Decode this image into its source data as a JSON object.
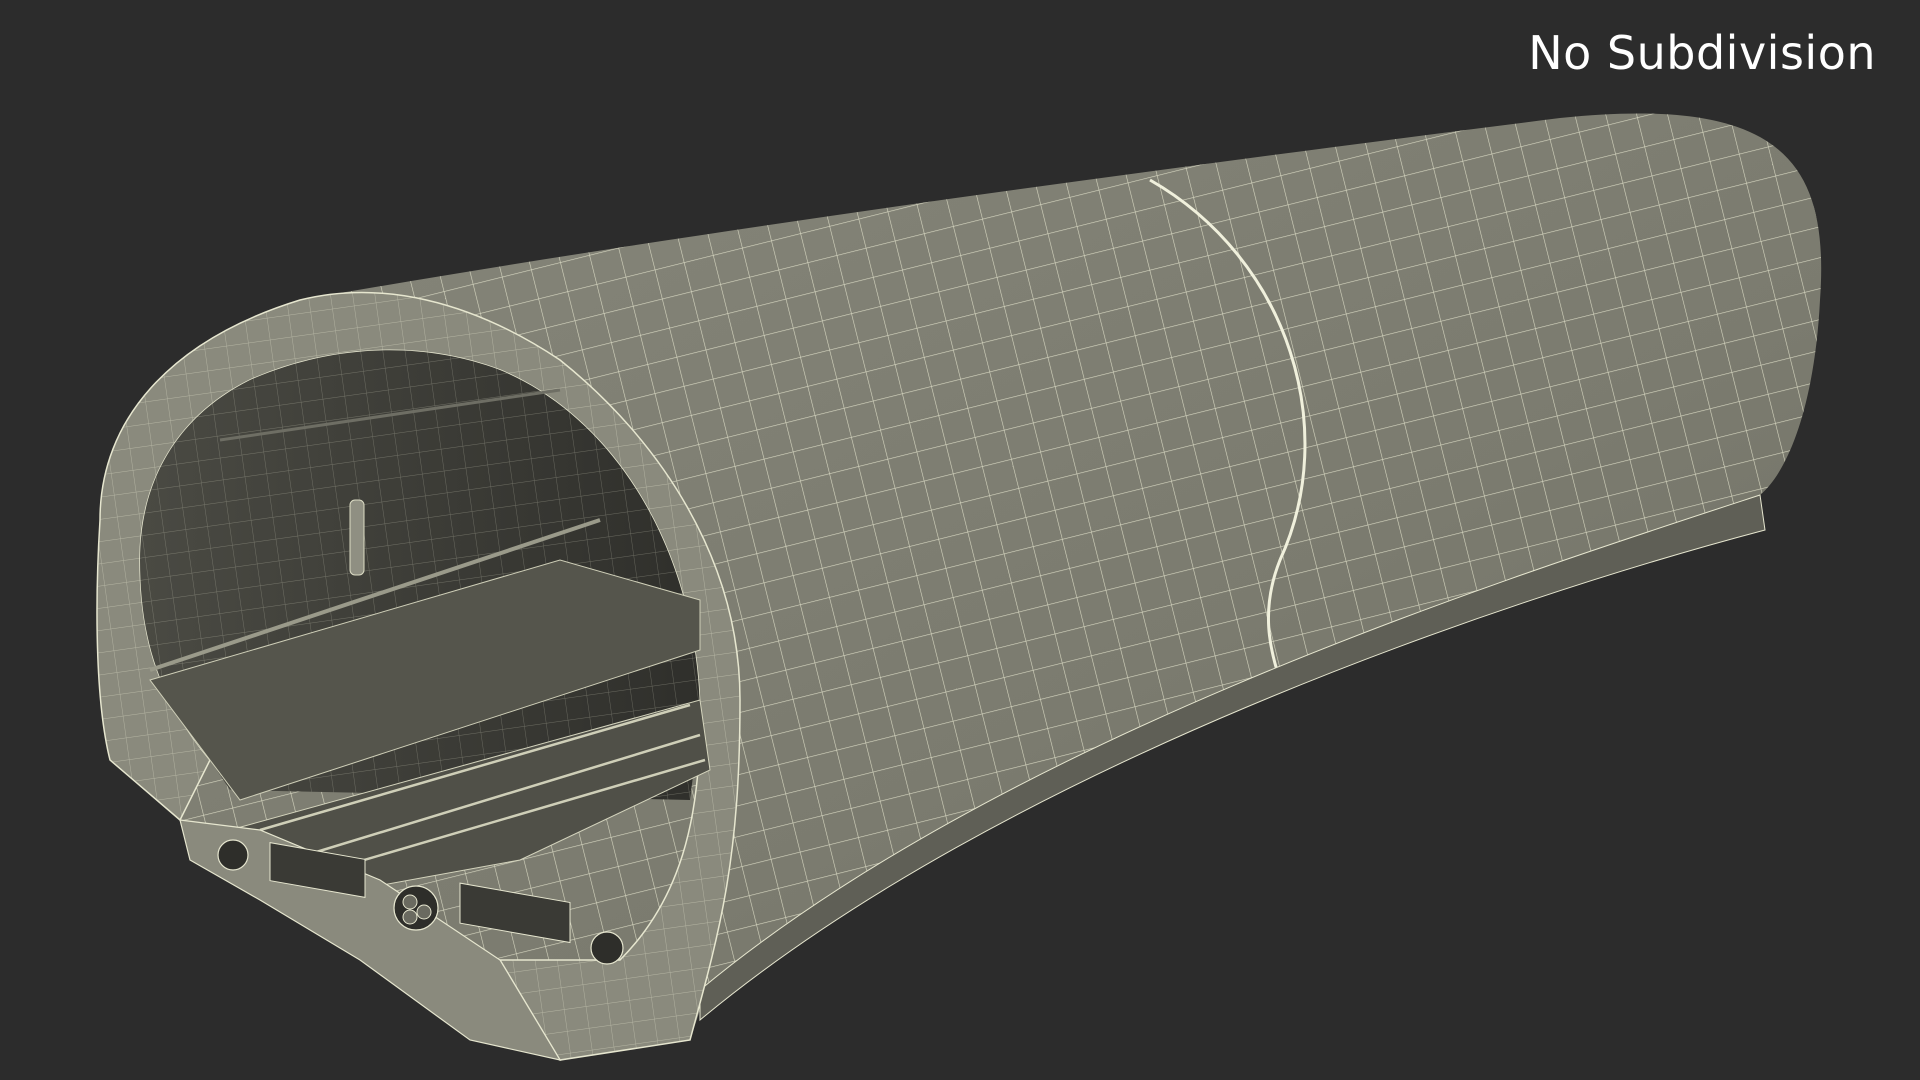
{
  "label": "No Subdivision",
  "colors": {
    "background": "#2c2c2c",
    "shell": "#7d7d70",
    "shell_dark": "#6a6a5f",
    "interior": "#3f3f3a",
    "interior_far": "#30302c",
    "wire": "#e6e6cf"
  }
}
